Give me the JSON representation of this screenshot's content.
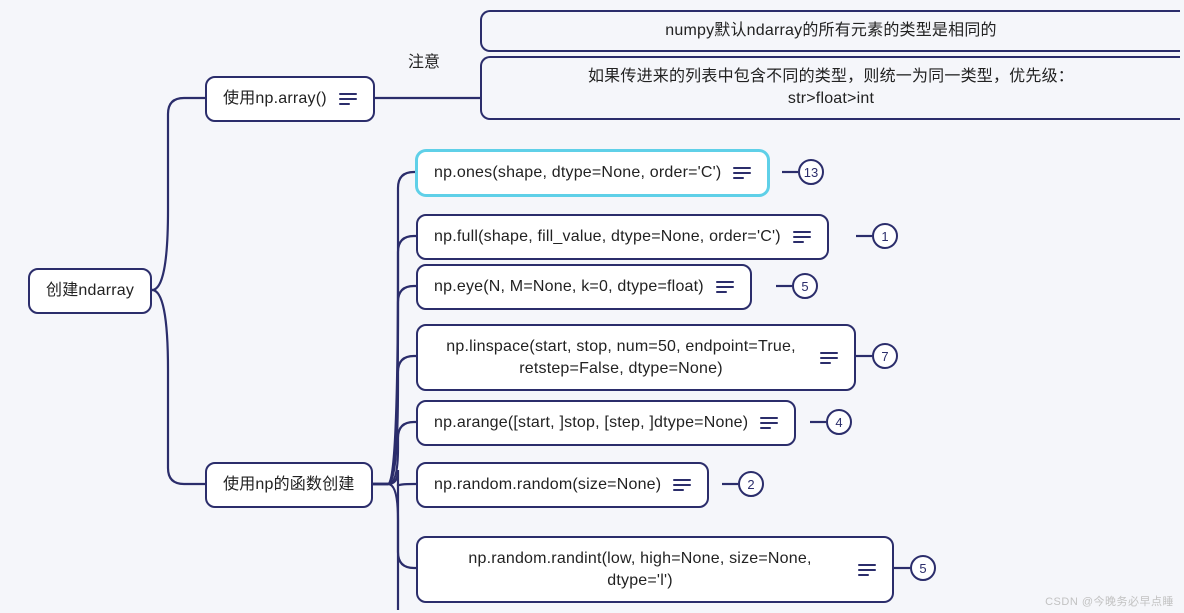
{
  "root": {
    "label": "创建ndarray"
  },
  "branch1": {
    "label": "使用np.array()",
    "edge_label": "注意",
    "note1": "numpy默认ndarray的所有元素的类型是相同的",
    "note2": "如果传进来的列表中包含不同的类型，则统一为同一类型，优先级：str>float>int"
  },
  "branch2": {
    "label": "使用np的函数创建",
    "items": [
      {
        "text": "np.ones(shape, dtype=None, order='C')",
        "badge": "13",
        "selected": true
      },
      {
        "text": "np.full(shape, fill_value, dtype=None, order='C')",
        "badge": "1"
      },
      {
        "text": "np.eye(N, M=None, k=0, dtype=float)",
        "badge": "5"
      },
      {
        "text": "np.linspace(start, stop, num=50, endpoint=True, retstep=False, dtype=None)",
        "badge": "7"
      },
      {
        "text": "np.arange([start, ]stop, [step, ]dtype=None)",
        "badge": "4"
      },
      {
        "text": "np.random.random(size=None)",
        "badge": "2"
      },
      {
        "text": "np.random.randint(low, high=None, size=None, dtype='l')",
        "badge": "5"
      }
    ]
  },
  "watermark": "CSDN @今晚务必早点睡"
}
